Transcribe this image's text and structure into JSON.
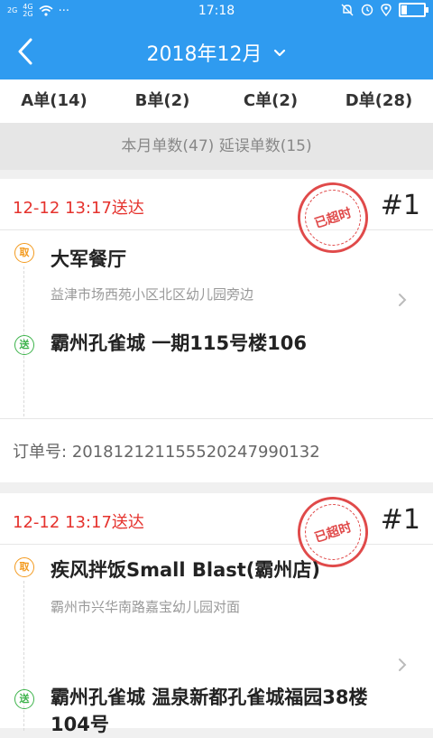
{
  "status_bar": {
    "network_1": "2G",
    "network_2": "4G",
    "network_3": "2G",
    "time": "17:18",
    "dots": "···"
  },
  "header": {
    "title": "2018年12月"
  },
  "tabs": [
    {
      "label": "A单(14)"
    },
    {
      "label": "B单(2)"
    },
    {
      "label": "C单(2)"
    },
    {
      "label": "D单(28)"
    }
  ],
  "summary": "本月单数(47) 延误单数(15)",
  "orders": [
    {
      "delivered_time": "12-12 13:17送达",
      "stamp": "已超时",
      "number": "#1",
      "pickup_badge": "取",
      "pickup_name": "大军餐厅",
      "pickup_address": "益津市场西苑小区北区幼儿园旁边",
      "dropoff_badge": "送",
      "dropoff_name": "霸州孔雀城 一期115号楼106",
      "order_label": "订单号:",
      "order_id": "201812121155520247990132"
    },
    {
      "delivered_time": "12-12 13:17送达",
      "stamp": "已超时",
      "number": "#1",
      "pickup_badge": "取",
      "pickup_name": "疾风拌饭Small Blast(霸州店)",
      "pickup_address": "霸州市兴华南路嘉宝幼儿园对面",
      "dropoff_badge": "送",
      "dropoff_name": "霸州孔雀城 温泉新都孔雀城福园38楼104号"
    }
  ],
  "colors": {
    "brand_blue": "#2f9bf0",
    "overdue_red": "#e5322d",
    "pickup_orange": "#f39a1e",
    "dropoff_green": "#3cb34a"
  },
  "icons": {
    "back": "back-arrow-icon",
    "dropdown": "chevron-down-icon",
    "detail": "chevron-right-icon"
  }
}
